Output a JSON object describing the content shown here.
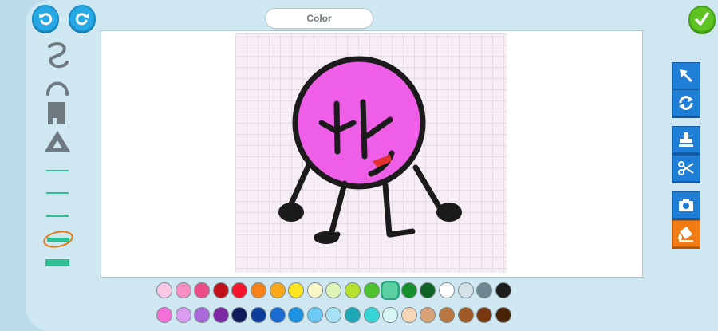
{
  "app": {
    "color_label": "Color"
  },
  "toolbar_top": {
    "undo_icon": "undo-arrow-icon",
    "redo_icon": "redo-arrow-icon",
    "confirm_icon": "checkmark-icon"
  },
  "left_tools": {
    "pen_sizes": 5,
    "selected_pen_size_index": 3
  },
  "right_tools": {
    "items": [
      "select-arrow-icon",
      "rotate-icon",
      "stamp-icon",
      "scissors-icon",
      "camera-icon",
      "paint-bucket-icon"
    ],
    "active": "paint-bucket-icon"
  },
  "palette": {
    "row1": [
      "#f9c8e4",
      "#f48ec3",
      "#ec4d86",
      "#c0101a",
      "#f4152d",
      "#f6821a",
      "#f8a718",
      "#fbe51e",
      "#f9f7c5",
      "#dff5b7",
      "#b6e12c",
      "#4ec12e",
      "#5cd0a3",
      "#16902f",
      "#0f6226",
      "#ffffff",
      "#d4e2e7",
      "#6e8690",
      "#1c1c1c"
    ],
    "row2": [
      "#f46fd7",
      "#d99cf0",
      "#a76ad8",
      "#7b2aa4",
      "#101a5a",
      "#0e3e9c",
      "#1a6bd1",
      "#1c93e3",
      "#6dcaf4",
      "#a6e1f5",
      "#1ea7b5",
      "#37d6d6",
      "#d7f8f6",
      "#f5d7b8",
      "#d7a275",
      "#b87740",
      "#9f5925",
      "#7a3810",
      "#4a2306"
    ],
    "selected_index_row1": 12
  }
}
